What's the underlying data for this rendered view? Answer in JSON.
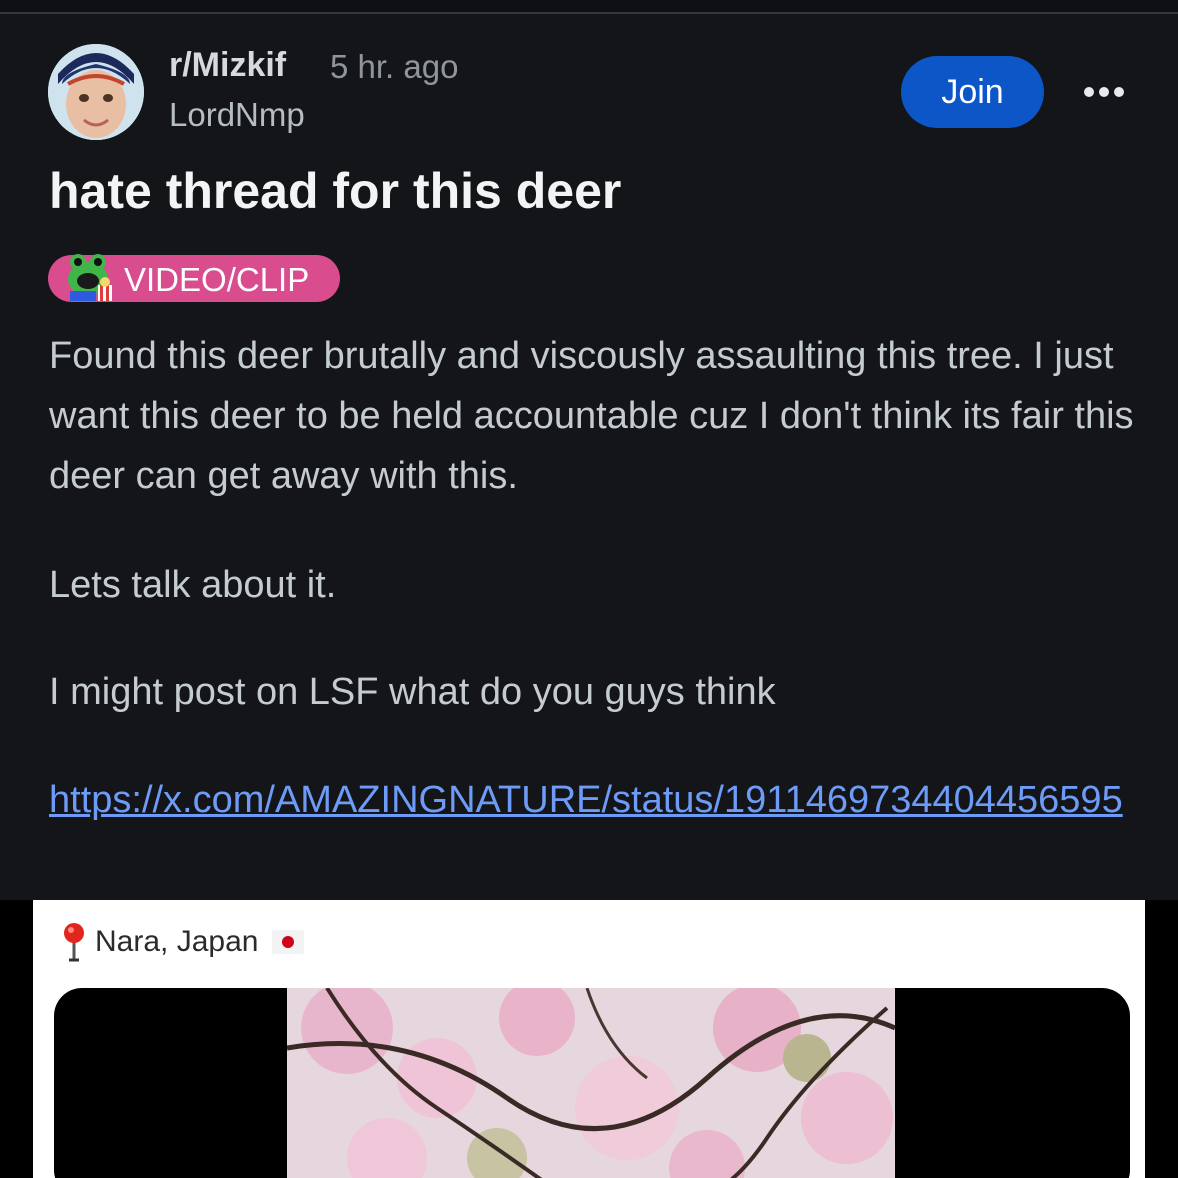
{
  "post": {
    "subreddit": "r/Mizkif",
    "time_ago": "5 hr. ago",
    "author": "LordNmp",
    "join_label": "Join",
    "more_icon": "more-dots-icon",
    "title": "hate thread for this deer",
    "flair": "VIDEO/CLIP",
    "body": [
      "Found this deer brutally and viscously assaulting this tree. I just want this deer to be held accountable cuz I don't think its fair this deer can get away with this.",
      "Lets talk about it.",
      "I might post on LSF what do you guys think"
    ],
    "link": "https://x.com/AMAZINGNATURE/status/1911469734404456595"
  },
  "embed": {
    "location": "Nara, Japan",
    "pin_icon": "round-pushpin-icon",
    "flag_icon": "japan-flag-icon"
  },
  "colors": {
    "background": "#131518",
    "join": "#0c56c8",
    "flair": "#d94c8d",
    "link": "#6d9bf7"
  }
}
